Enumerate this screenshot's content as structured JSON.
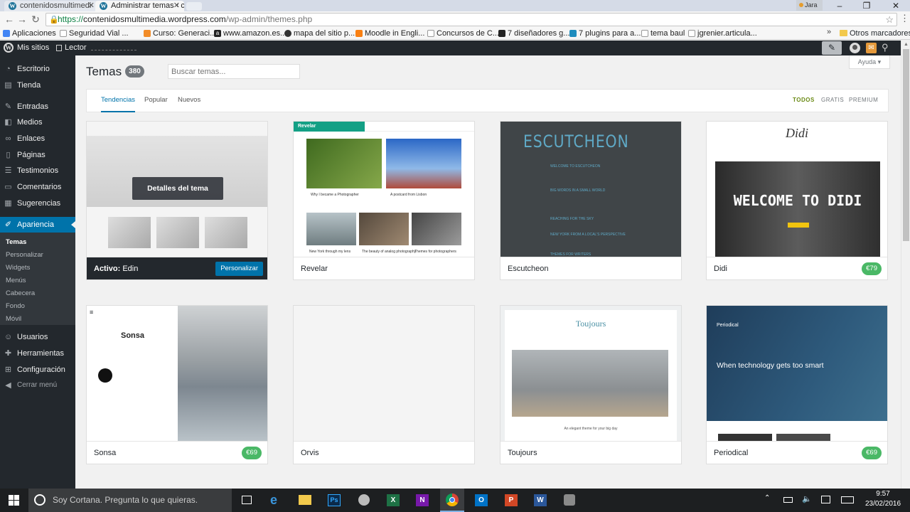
{
  "browser": {
    "tabs": [
      {
        "title": "contenidosmultimedi"
      },
      {
        "title": "Administrar temas ‹ c"
      }
    ],
    "profile_name": "Jara",
    "url_protocol": "https://",
    "url_host": "contenidosmultimedia.wordpress.com",
    "url_path": "/wp-admin/themes.php",
    "bookmarks": [
      {
        "label": "Aplicaciones",
        "color": "#4285f4"
      },
      {
        "label": "Seguridad Vial ...",
        "color": "#999999"
      },
      {
        "label": "Curso: Generaci...",
        "color": "#f28c28"
      },
      {
        "label": "www.amazon.es...",
        "color": "#222222"
      },
      {
        "label": "mapa del sitio p...",
        "color": "#333333"
      },
      {
        "label": "Moodle in Engli...",
        "color": "#f98012"
      },
      {
        "label": "Concursos de C...",
        "color": "#999999"
      },
      {
        "label": "7 diseñadores g...",
        "color": "#222222"
      },
      {
        "label": "7 plugins para a...",
        "color": "#1e8cbe"
      },
      {
        "label": "tema baul",
        "color": "#999999"
      },
      {
        "label": "jgrenier.articula...",
        "color": "#999999"
      }
    ],
    "bookmarks_more": "»",
    "other_bookmarks": "Otros marcadores"
  },
  "wp_bar": {
    "my_sites": "Mis sitios",
    "reader": "Lector"
  },
  "sidebar": {
    "items": [
      {
        "label": "Escritorio",
        "icon": "dashboard-icon"
      },
      {
        "label": "Tienda",
        "icon": "store-icon"
      },
      {
        "label": "Entradas",
        "icon": "pin-icon"
      },
      {
        "label": "Medios",
        "icon": "media-icon"
      },
      {
        "label": "Enlaces",
        "icon": "link-icon"
      },
      {
        "label": "Páginas",
        "icon": "pages-icon"
      },
      {
        "label": "Testimonios",
        "icon": "testimonial-icon"
      },
      {
        "label": "Comentarios",
        "icon": "comments-icon"
      },
      {
        "label": "Sugerencias",
        "icon": "feedback-icon"
      },
      {
        "label": "Apariencia",
        "icon": "brush-icon"
      },
      {
        "label": "Usuarios",
        "icon": "users-icon"
      },
      {
        "label": "Herramientas",
        "icon": "tools-icon"
      },
      {
        "label": "Configuración",
        "icon": "settings-icon"
      },
      {
        "label": "Cerrar menú",
        "icon": "collapse-icon"
      }
    ],
    "submenu": [
      "Temas",
      "Personalizar",
      "Widgets",
      "Menús",
      "Cabecera",
      "Fondo",
      "Móvil"
    ]
  },
  "page": {
    "title": "Temas",
    "count": "380",
    "search_placeholder": "Buscar temas...",
    "help": "Ayuda",
    "tabs": [
      "Tendencias",
      "Popular",
      "Nuevos"
    ],
    "price_filters": [
      "TODOS",
      "GRATIS",
      "PREMIUM"
    ]
  },
  "themes": {
    "edin": {
      "name": "Edin",
      "active_prefix": "Activo:",
      "details": "Detalles del tema",
      "customize": "Personalizar"
    },
    "revelar": {
      "name": "Revelar",
      "logo": "Revelar",
      "captions": [
        "Why I became a Photographer",
        "A postcard from Lisbon",
        "New York through my lens",
        "The beauty of analog photography",
        "Themes for photographers"
      ]
    },
    "escutcheon": {
      "name": "Escutcheon",
      "header": "ESCUTCHEON",
      "posts": [
        "WELCOME TO ESCUTCHEON",
        "BIG WORDS IN A SMALL WORLD",
        "REACHING FOR THE SKY",
        "NEW YORK FROM A LOCAL'S PERSPECTIVE",
        "THEMES FOR WRITERS"
      ]
    },
    "didi": {
      "name": "Didi",
      "price": "€79",
      "logo": "Didi",
      "welcome": "WELCOME TO DIDI"
    },
    "sonsa": {
      "name": "Sonsa",
      "price": "€69",
      "title": "Sonsa"
    },
    "orvis": {
      "name": "Orvis"
    },
    "toujours": {
      "name": "Toujours",
      "title": "Toujours",
      "tagline": "An elegant theme for your big day"
    },
    "periodical": {
      "name": "Periodical",
      "price": "€69",
      "headline": "When technology gets too smart",
      "logo": "Periodical"
    }
  },
  "taskbar": {
    "cortana": "Soy Cortana. Pregunta lo que quieras.",
    "time": "9:57",
    "date": "23/02/2016"
  },
  "colors": {
    "accent": "#0073aa",
    "price_badge": "#4ab866",
    "admin_bg": "#23282d"
  }
}
